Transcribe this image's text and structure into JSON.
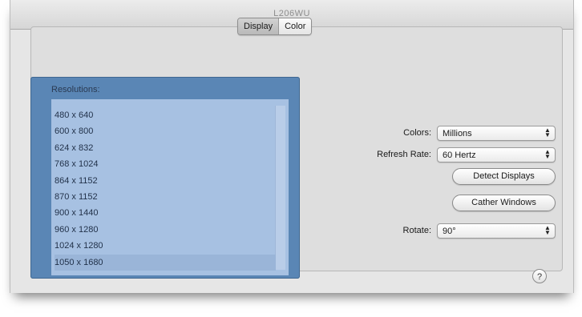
{
  "window": {
    "title": "L206WU"
  },
  "tabs": [
    {
      "label": "Display",
      "active": true
    },
    {
      "label": "Color",
      "active": false
    }
  ],
  "resolutions": {
    "label": "Resolutions:",
    "items": [
      "480 x 640",
      "600 x 800",
      "624 x 832",
      "768 x 1024",
      "864 x 1152",
      "870 x 1152",
      "900 x 1440",
      "960 x 1280",
      "1024 x 1280",
      "1050 x 1680"
    ],
    "selected": "1050 x 1680"
  },
  "colors": {
    "label": "Colors:",
    "value": "Millions"
  },
  "refresh_rate": {
    "label": "Refresh Rate:",
    "value": "60 Hertz"
  },
  "buttons": {
    "detect_displays": "Detect Displays",
    "gather_windows": "Cather Windows"
  },
  "rotate": {
    "label": "Rotate:",
    "value": "90°"
  },
  "help": {
    "label": "?"
  }
}
